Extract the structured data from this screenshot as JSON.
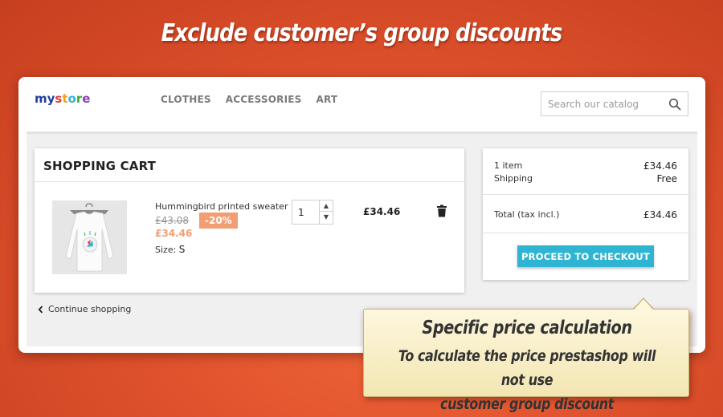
{
  "banner": {
    "title": "Exclude customer’s group discounts"
  },
  "header": {
    "logo": {
      "parts": [
        {
          "text": "my ",
          "color": "#1f3f9e"
        },
        {
          "text": "s",
          "color": "#e23b3b"
        },
        {
          "text": "t",
          "color": "#f0a21c"
        },
        {
          "text": "o",
          "color": "#2fb5d2"
        },
        {
          "text": "r",
          "color": "#3aa83a"
        },
        {
          "text": "e",
          "color": "#8b3fae"
        }
      ]
    },
    "nav": [
      "CLOTHES",
      "ACCESSORIES",
      "ART"
    ],
    "search": {
      "placeholder": "Search our catalog",
      "icon": "search-icon"
    }
  },
  "cart": {
    "title": "SHOPPING CART",
    "item": {
      "name": "Hummingbird printed sweater",
      "old_price": "£43.08",
      "discount": "-20%",
      "new_price": "£34.46",
      "size_label": "Size:",
      "size_value": "S",
      "quantity": "1",
      "line_total": "£34.46",
      "delete_icon": "trash-icon"
    },
    "continue_label": "Continue shopping",
    "continue_icon": "chevron-left-icon"
  },
  "summary": {
    "items_label": "1 item",
    "items_value": "£34.46",
    "shipping_label": "Shipping",
    "shipping_value": "Free",
    "total_label": "Total (tax incl.)",
    "total_value": "£34.46",
    "checkout_label": "PROCEED TO CHECKOUT"
  },
  "callout": {
    "title": "Specific price calculation",
    "line1": "To calculate the price prestashop will not use",
    "line2": "customer group discount"
  },
  "colors": {
    "accent": "#2fb5d2",
    "discount": "#f39d72",
    "background": "#e0522d"
  }
}
